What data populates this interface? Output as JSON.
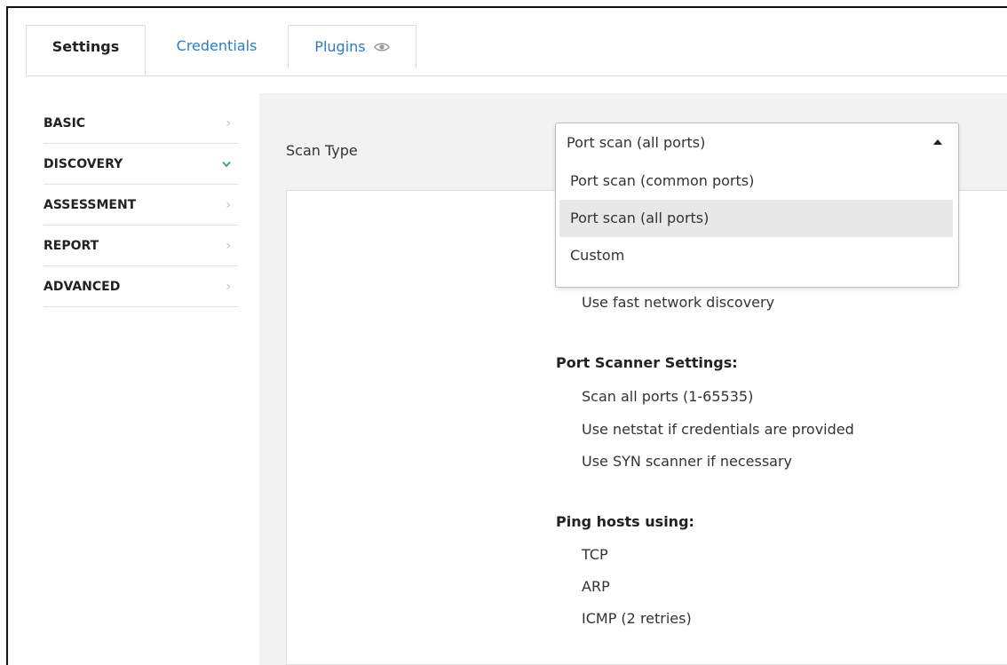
{
  "tabs": [
    {
      "label": "Settings"
    },
    {
      "label": "Credentials"
    },
    {
      "label": "Plugins",
      "icon": "eye-icon"
    }
  ],
  "sidebar": {
    "items": [
      {
        "label": "BASIC",
        "icon": "chevron-right-icon"
      },
      {
        "label": "DISCOVERY",
        "icon": "check-icon"
      },
      {
        "label": "ASSESSMENT",
        "icon": "chevron-right-icon"
      },
      {
        "label": "REPORT",
        "icon": "chevron-right-icon"
      },
      {
        "label": "ADVANCED",
        "icon": "chevron-right-icon"
      }
    ]
  },
  "scan_type": {
    "label": "Scan Type",
    "selected": "Port scan (all ports)",
    "options": [
      "Port scan (common ports)",
      "Port scan (all ports)",
      "Custom"
    ]
  },
  "summary": {
    "discovery_item": "Use fast network discovery",
    "port_scanner_heading": "Port Scanner Settings:",
    "port_scanner_items": [
      "Scan all ports (1-65535)",
      "Use netstat if credentials are provided",
      "Use SYN scanner if necessary"
    ],
    "ping_heading": "Ping hosts using:",
    "ping_items": [
      "TCP",
      "ARP",
      "ICMP (2 retries)"
    ]
  },
  "colors": {
    "link": "#2c7cc1",
    "check": "#3aa65a",
    "panel_bg": "#f2f2f2"
  }
}
